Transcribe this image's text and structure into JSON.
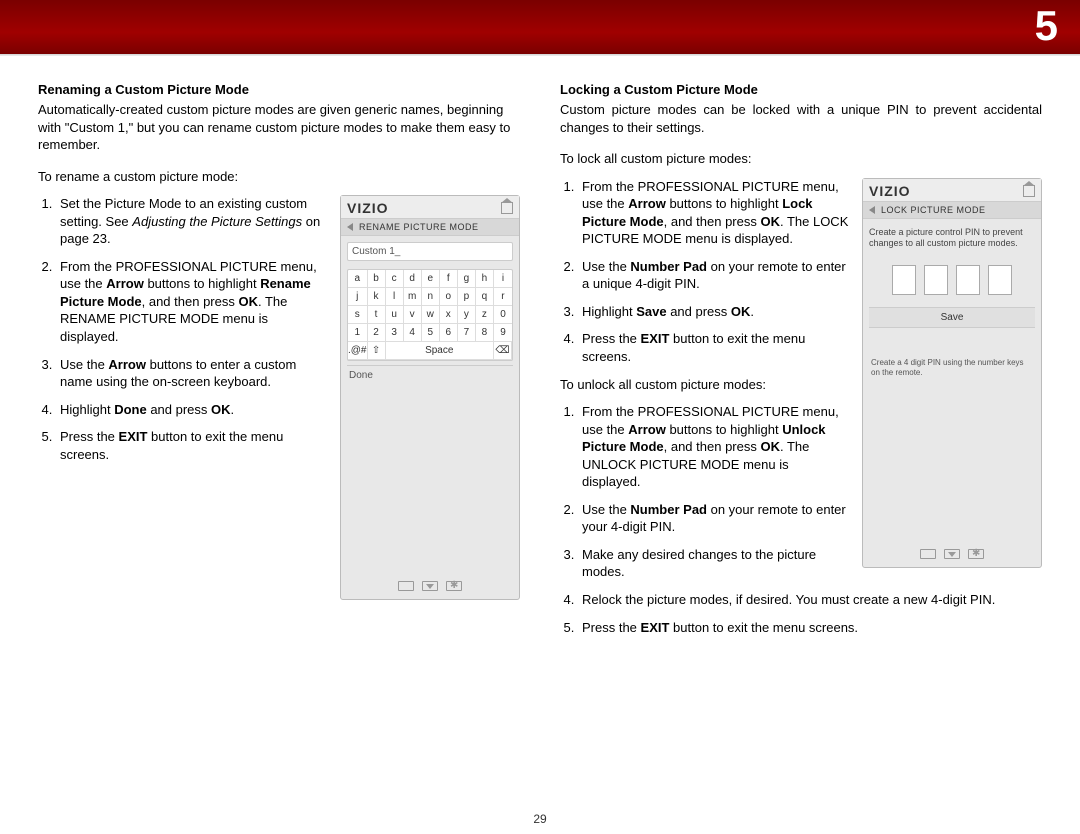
{
  "chapter": "5",
  "page_number": "29",
  "left": {
    "heading": "Renaming a Custom Picture Mode",
    "intro": "Automatically-created custom picture modes are given generic names, beginning with \"Custom 1,\" but you can rename custom picture modes to make them easy to remember.",
    "lead": "To rename a custom picture mode:",
    "steps": {
      "s1a": "Set the Picture Mode to an existing custom setting. See ",
      "s1b": "Adjusting the Picture Settings",
      "s1c": " on page 23.",
      "s2a": "From the PROFESSIONAL PICTURE menu, use the ",
      "s2b": "Arrow",
      "s2c": " buttons to highlight ",
      "s2d": "Rename Picture Mode",
      "s2e": ", and then press ",
      "s2f": "OK",
      "s2g": ". The RENAME PICTURE MODE menu is displayed.",
      "s3a": "Use the ",
      "s3b": "Arrow",
      "s3c": " buttons to enter a custom name using the on-screen keyboard.",
      "s4a": "Highlight ",
      "s4b": "Done",
      "s4c": " and press ",
      "s4d": "OK",
      "s4e": ".",
      "s5a": "Press the ",
      "s5b": "EXIT",
      "s5c": " button to exit the menu screens."
    },
    "panel": {
      "brand": "VIZIO",
      "title": "RENAME PICTURE MODE",
      "field": "Custom 1_",
      "keys": [
        "a",
        "b",
        "c",
        "d",
        "e",
        "f",
        "g",
        "h",
        "i",
        "j",
        "k",
        "l",
        "m",
        "n",
        "o",
        "p",
        "q",
        "r",
        "s",
        "t",
        "u",
        "v",
        "w",
        "x",
        "y",
        "z",
        "0",
        "1",
        "2",
        "3",
        "4",
        "5",
        "6",
        "7",
        "8",
        "9"
      ],
      "sym": ".@#",
      "shift": "⇧",
      "space": "Space",
      "bksp": "⌫",
      "done": "Done"
    }
  },
  "right": {
    "heading": "Locking a Custom Picture Mode",
    "intro": "Custom picture modes can be locked with a unique PIN to prevent accidental changes to their settings.",
    "lead1": "To lock all custom picture modes:",
    "lock_steps": {
      "s1a": "From the PROFESSIONAL PICTURE menu, use the ",
      "s1b": "Arrow",
      "s1c": " buttons to highlight ",
      "s1d": "Lock Picture Mode",
      "s1e": ", and then press ",
      "s1f": "OK",
      "s1g": ". The LOCK PICTURE MODE menu is displayed.",
      "s2a": "Use the ",
      "s2b": "Number Pad",
      "s2c": " on your remote to enter a unique 4-digit PIN.",
      "s3a": "Highlight ",
      "s3b": "Save",
      "s3c": " and press ",
      "s3d": "OK",
      "s3e": ".",
      "s4a": "Press the ",
      "s4b": "EXIT",
      "s4c": " button to exit the menu screens."
    },
    "lead2": "To unlock all custom picture modes:",
    "unlock_steps": {
      "s1a": "From the PROFESSIONAL PICTURE menu, use the ",
      "s1b": "Arrow",
      "s1c": " buttons to highlight ",
      "s1d": "Unlock Picture Mode",
      "s1e": ", and then press ",
      "s1f": "OK",
      "s1g": ". The UNLOCK PICTURE MODE menu is displayed.",
      "s2a": "Use the ",
      "s2b": "Number Pad",
      "s2c": " on your remote to enter your 4-digit PIN.",
      "s3": "Make any desired changes to the picture modes.",
      "s4": "Relock the picture modes, if desired. You must create a new 4-digit PIN.",
      "s5a": "Press the ",
      "s5b": "EXIT",
      "s5c": " button to exit the menu screens."
    },
    "panel": {
      "brand": "VIZIO",
      "title": "LOCK PICTURE MODE",
      "desc": "Create a picture control PIN to prevent changes to all custom picture modes.",
      "save": "Save",
      "note": "Create a 4 digit PIN using the number keys on the remote."
    }
  }
}
